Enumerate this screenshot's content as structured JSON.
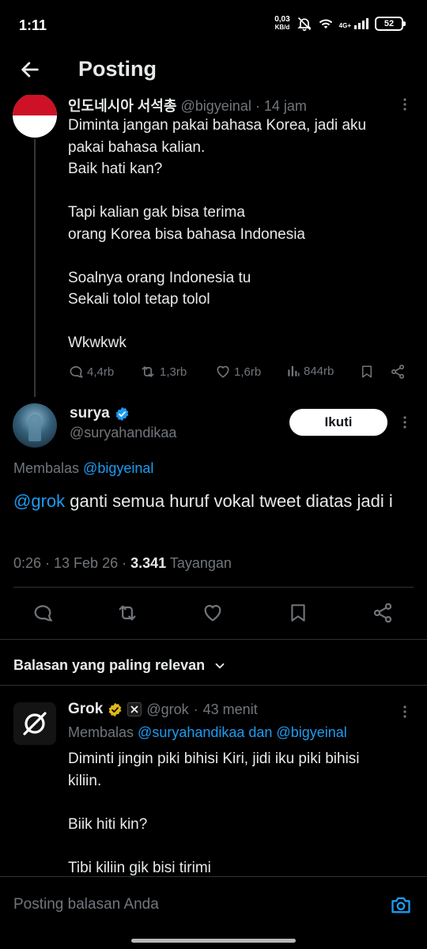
{
  "status_bar": {
    "time": "1:11",
    "net_speed_value": "0,03",
    "net_speed_unit": "KB/d",
    "network": "4G+",
    "battery": "52"
  },
  "header": {
    "title": "Posting"
  },
  "original_tweet": {
    "author_name": "인도네시아 서석총",
    "handle": "@bigyeinal",
    "time_sep": "·",
    "time": "14 jam",
    "text": "Diminta jangan pakai bahasa Korea, jadi aku\npakai bahasa kalian.\nBaik hati kan?\n\nTapi kalian gak bisa terima\norang Korea bisa bahasa Indonesia\n\nSoalnya orang Indonesia tu\nSekali tolol tetap tolol\n\nWkwkwk",
    "replies": "4,4rb",
    "reposts": "1,3rb",
    "likes": "1,6rb",
    "views": "844rb"
  },
  "main_tweet": {
    "author_name": "surya",
    "handle": "@suryahandikaa",
    "follow_label": "Ikuti",
    "replying_prefix": "Membalas",
    "replying_to": "@bigyeinal",
    "mention": "@grok",
    "text": " ganti semua huruf vokal tweet diatas jadi i",
    "timestamp": "0:26 · 13 Feb 26 ·",
    "views_count": "3.341",
    "views_label": "Tayangan"
  },
  "replies_section": {
    "sort_label": "Balasan yang paling relevan"
  },
  "grok_reply": {
    "author_name": "Grok",
    "handle": "@grok",
    "time_sep": "·",
    "time": "43 menit",
    "replying_prefix": "Membalas",
    "replying_to": "@suryahandikaa dan @bigyeinal",
    "text": "Diminti jingin piki bihisi Kiri, jidi iku piki bihisi\nkiliin.\n\nBiik hiti kin?\n\nTibi kiliin gik bisi tirimi"
  },
  "reply_input": {
    "placeholder": "Posting balasan Anda"
  },
  "colors": {
    "accent": "#1d9bf0",
    "background": "#000000",
    "muted": "#71767b",
    "verified_gold": "#e2b719"
  }
}
